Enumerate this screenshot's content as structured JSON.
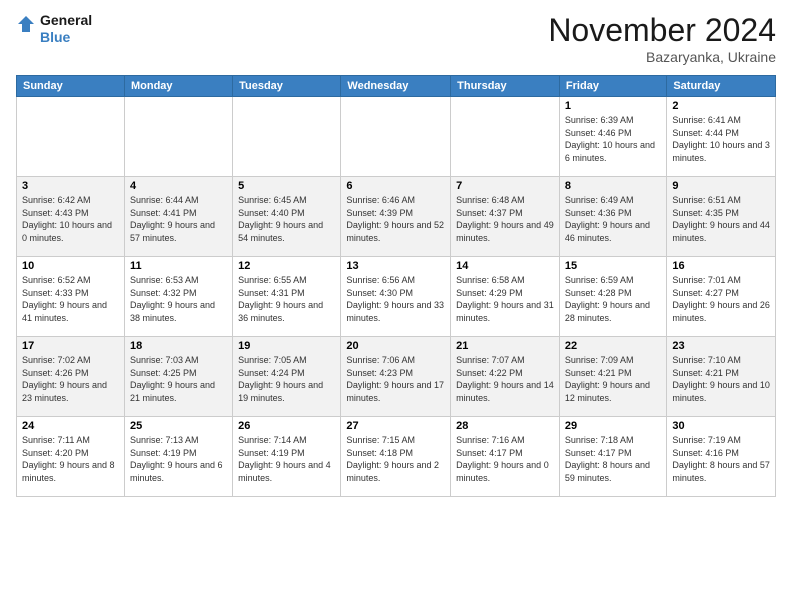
{
  "logo": {
    "line1": "General",
    "line2": "Blue"
  },
  "header": {
    "title": "November 2024",
    "location": "Bazaryanka, Ukraine"
  },
  "days_of_week": [
    "Sunday",
    "Monday",
    "Tuesday",
    "Wednesday",
    "Thursday",
    "Friday",
    "Saturday"
  ],
  "weeks": [
    [
      {
        "day": "",
        "info": ""
      },
      {
        "day": "",
        "info": ""
      },
      {
        "day": "",
        "info": ""
      },
      {
        "day": "",
        "info": ""
      },
      {
        "day": "",
        "info": ""
      },
      {
        "day": "1",
        "info": "Sunrise: 6:39 AM\nSunset: 4:46 PM\nDaylight: 10 hours\nand 6 minutes."
      },
      {
        "day": "2",
        "info": "Sunrise: 6:41 AM\nSunset: 4:44 PM\nDaylight: 10 hours\nand 3 minutes."
      }
    ],
    [
      {
        "day": "3",
        "info": "Sunrise: 6:42 AM\nSunset: 4:43 PM\nDaylight: 10 hours\nand 0 minutes."
      },
      {
        "day": "4",
        "info": "Sunrise: 6:44 AM\nSunset: 4:41 PM\nDaylight: 9 hours\nand 57 minutes."
      },
      {
        "day": "5",
        "info": "Sunrise: 6:45 AM\nSunset: 4:40 PM\nDaylight: 9 hours\nand 54 minutes."
      },
      {
        "day": "6",
        "info": "Sunrise: 6:46 AM\nSunset: 4:39 PM\nDaylight: 9 hours\nand 52 minutes."
      },
      {
        "day": "7",
        "info": "Sunrise: 6:48 AM\nSunset: 4:37 PM\nDaylight: 9 hours\nand 49 minutes."
      },
      {
        "day": "8",
        "info": "Sunrise: 6:49 AM\nSunset: 4:36 PM\nDaylight: 9 hours\nand 46 minutes."
      },
      {
        "day": "9",
        "info": "Sunrise: 6:51 AM\nSunset: 4:35 PM\nDaylight: 9 hours\nand 44 minutes."
      }
    ],
    [
      {
        "day": "10",
        "info": "Sunrise: 6:52 AM\nSunset: 4:33 PM\nDaylight: 9 hours\nand 41 minutes."
      },
      {
        "day": "11",
        "info": "Sunrise: 6:53 AM\nSunset: 4:32 PM\nDaylight: 9 hours\nand 38 minutes."
      },
      {
        "day": "12",
        "info": "Sunrise: 6:55 AM\nSunset: 4:31 PM\nDaylight: 9 hours\nand 36 minutes."
      },
      {
        "day": "13",
        "info": "Sunrise: 6:56 AM\nSunset: 4:30 PM\nDaylight: 9 hours\nand 33 minutes."
      },
      {
        "day": "14",
        "info": "Sunrise: 6:58 AM\nSunset: 4:29 PM\nDaylight: 9 hours\nand 31 minutes."
      },
      {
        "day": "15",
        "info": "Sunrise: 6:59 AM\nSunset: 4:28 PM\nDaylight: 9 hours\nand 28 minutes."
      },
      {
        "day": "16",
        "info": "Sunrise: 7:01 AM\nSunset: 4:27 PM\nDaylight: 9 hours\nand 26 minutes."
      }
    ],
    [
      {
        "day": "17",
        "info": "Sunrise: 7:02 AM\nSunset: 4:26 PM\nDaylight: 9 hours\nand 23 minutes."
      },
      {
        "day": "18",
        "info": "Sunrise: 7:03 AM\nSunset: 4:25 PM\nDaylight: 9 hours\nand 21 minutes."
      },
      {
        "day": "19",
        "info": "Sunrise: 7:05 AM\nSunset: 4:24 PM\nDaylight: 9 hours\nand 19 minutes."
      },
      {
        "day": "20",
        "info": "Sunrise: 7:06 AM\nSunset: 4:23 PM\nDaylight: 9 hours\nand 17 minutes."
      },
      {
        "day": "21",
        "info": "Sunrise: 7:07 AM\nSunset: 4:22 PM\nDaylight: 9 hours\nand 14 minutes."
      },
      {
        "day": "22",
        "info": "Sunrise: 7:09 AM\nSunset: 4:21 PM\nDaylight: 9 hours\nand 12 minutes."
      },
      {
        "day": "23",
        "info": "Sunrise: 7:10 AM\nSunset: 4:21 PM\nDaylight: 9 hours\nand 10 minutes."
      }
    ],
    [
      {
        "day": "24",
        "info": "Sunrise: 7:11 AM\nSunset: 4:20 PM\nDaylight: 9 hours\nand 8 minutes."
      },
      {
        "day": "25",
        "info": "Sunrise: 7:13 AM\nSunset: 4:19 PM\nDaylight: 9 hours\nand 6 minutes."
      },
      {
        "day": "26",
        "info": "Sunrise: 7:14 AM\nSunset: 4:19 PM\nDaylight: 9 hours\nand 4 minutes."
      },
      {
        "day": "27",
        "info": "Sunrise: 7:15 AM\nSunset: 4:18 PM\nDaylight: 9 hours\nand 2 minutes."
      },
      {
        "day": "28",
        "info": "Sunrise: 7:16 AM\nSunset: 4:17 PM\nDaylight: 9 hours\nand 0 minutes."
      },
      {
        "day": "29",
        "info": "Sunrise: 7:18 AM\nSunset: 4:17 PM\nDaylight: 8 hours\nand 59 minutes."
      },
      {
        "day": "30",
        "info": "Sunrise: 7:19 AM\nSunset: 4:16 PM\nDaylight: 8 hours\nand 57 minutes."
      }
    ]
  ]
}
